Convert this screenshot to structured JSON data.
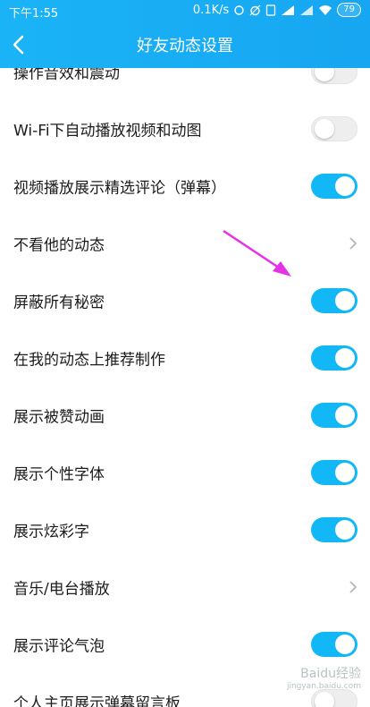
{
  "status": {
    "time": "下午1:55",
    "speed": "0.1K/s",
    "battery": "79"
  },
  "nav": {
    "title": "好友动态设置"
  },
  "rows": [
    {
      "label": "操作音效和震动",
      "control": "toggle",
      "state": "off"
    },
    {
      "label": "Wi-Fi下自动播放视频和动图",
      "control": "toggle",
      "state": "off"
    },
    {
      "label": "视频播放展示精选评论（弹幕）",
      "control": "toggle",
      "state": "on"
    },
    {
      "label": "不看他的动态",
      "control": "chevron"
    },
    {
      "label": "屏蔽所有秘密",
      "control": "toggle",
      "state": "on"
    },
    {
      "label": "在我的动态上推荐制作",
      "control": "toggle",
      "state": "on"
    },
    {
      "label": "展示被赞动画",
      "control": "toggle",
      "state": "on"
    },
    {
      "label": "展示个性字体",
      "control": "toggle",
      "state": "on"
    },
    {
      "label": "展示炫彩字",
      "control": "toggle",
      "state": "on"
    },
    {
      "label": "音乐/电台播放",
      "control": "chevron"
    },
    {
      "label": "展示评论气泡",
      "control": "toggle",
      "state": "on"
    },
    {
      "label": "个人主页展示弹幕留言板",
      "control": "toggle",
      "state": "off"
    }
  ],
  "colors": {
    "header": "#17a6f2",
    "toggle_on": "#12b7f5",
    "annotation_arrow": "#e632e6"
  },
  "watermark": {
    "main": "Baidu经验",
    "sub": "jingyan.baidu.com"
  }
}
